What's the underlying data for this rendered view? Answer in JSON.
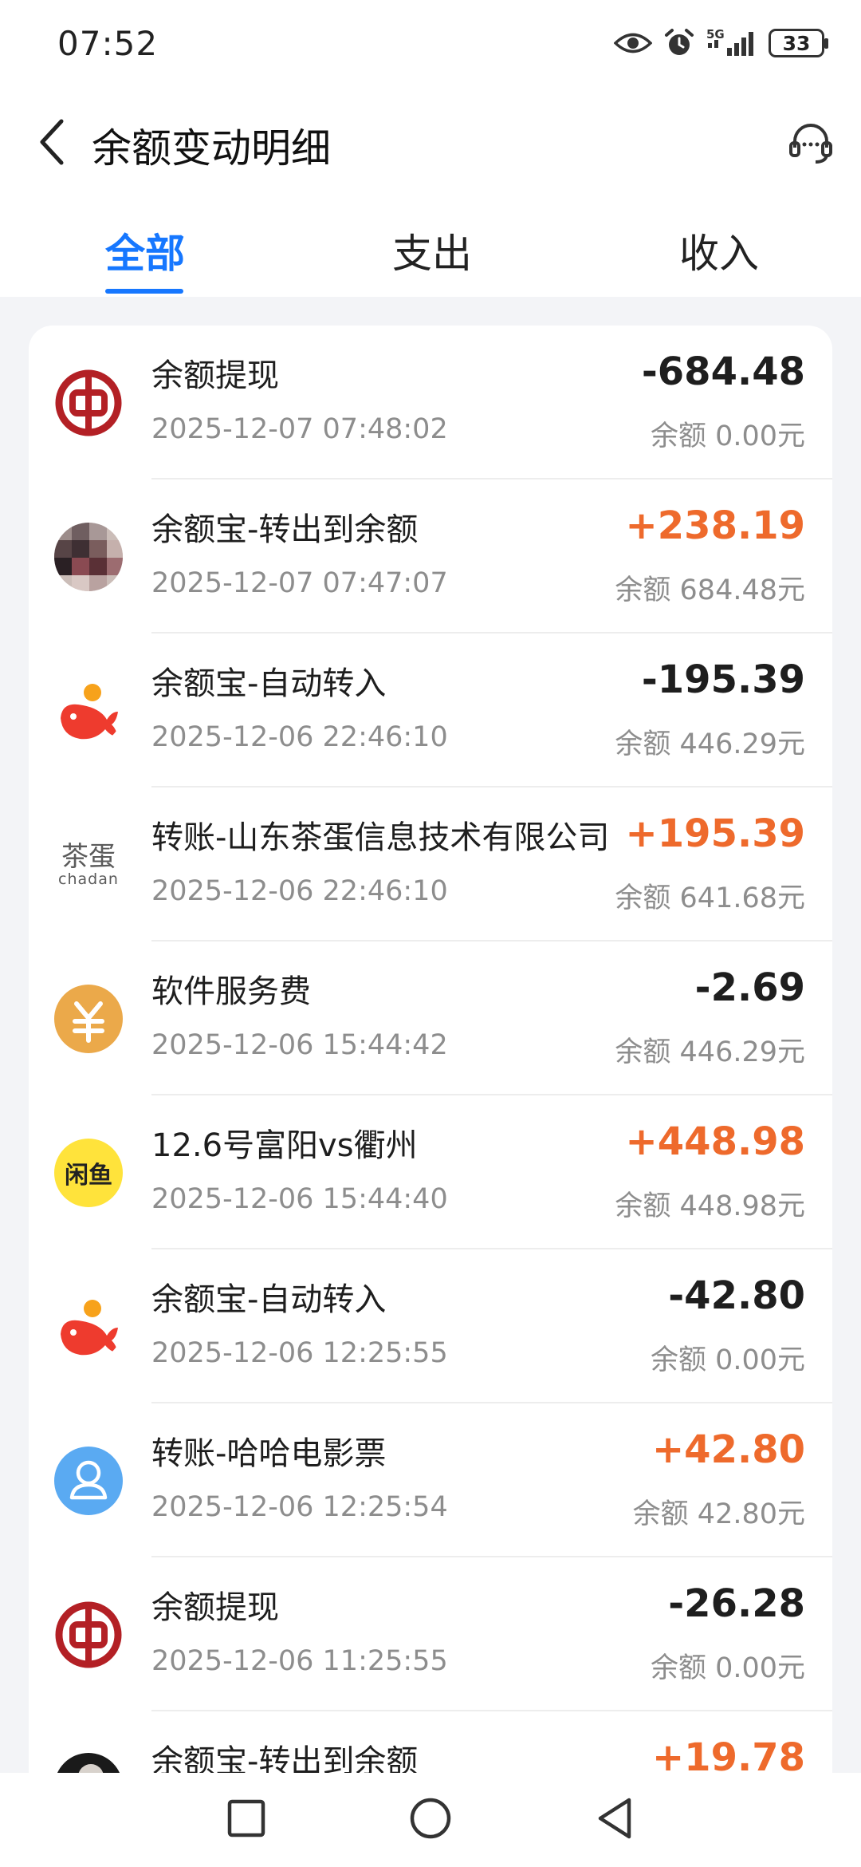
{
  "status_bar": {
    "time": "07:52",
    "network": "5G",
    "battery": "33"
  },
  "header": {
    "title": "余额变动明细"
  },
  "tabs": [
    {
      "label": "全部",
      "active": true
    },
    {
      "label": "支出",
      "active": false
    },
    {
      "label": "收入",
      "active": false
    }
  ],
  "colors": {
    "accent": "#1677ff",
    "income": "#ee6a2c",
    "expense": "#1e1e1e"
  },
  "transactions": [
    {
      "title": "余额提现",
      "time": "2025-12-07 07:48:02",
      "amount": "-684.48",
      "balance": "余额 0.00元",
      "icon": "bank-of-china-icon"
    },
    {
      "title": "余额宝-转出到余额",
      "time": "2025-12-07 07:47:07",
      "amount": "+238.19",
      "balance": "余额 684.48元",
      "icon": "blurred-avatar-icon"
    },
    {
      "title": "余额宝-自动转入",
      "time": "2025-12-06 22:46:10",
      "amount": "-195.39",
      "balance": "余额 446.29元",
      "icon": "yuebao-icon"
    },
    {
      "title": "转账-山东茶蛋信息技术有限公司",
      "time": "2025-12-06 22:46:10",
      "amount": "+195.39",
      "balance": "余额 641.68元",
      "icon": "chadan-logo-icon",
      "logo_text": "茶蛋",
      "logo_subtext": "chadan"
    },
    {
      "title": "软件服务费",
      "time": "2025-12-06 15:44:42",
      "amount": "-2.69",
      "balance": "余额 446.29元",
      "icon": "yuan-coin-icon"
    },
    {
      "title": "12.6号富阳vs衢州",
      "time": "2025-12-06 15:44:40",
      "amount": "+448.98",
      "balance": "余额 448.98元",
      "icon": "xianyu-logo-icon",
      "logo_text": "闲鱼"
    },
    {
      "title": "余额宝-自动转入",
      "time": "2025-12-06 12:25:55",
      "amount": "-42.80",
      "balance": "余额 0.00元",
      "icon": "yuebao-icon"
    },
    {
      "title": "转账-哈哈电影票",
      "time": "2025-12-06 12:25:54",
      "amount": "+42.80",
      "balance": "余额 42.80元",
      "icon": "user-avatar-icon"
    },
    {
      "title": "余额提现",
      "time": "2025-12-06 11:25:55",
      "amount": "-26.28",
      "balance": "余额 0.00元",
      "icon": "bank-of-china-icon"
    },
    {
      "title": "余额宝-转出到余额",
      "time": "",
      "amount": "+19.78",
      "balance": "",
      "icon": "dark-avatar-icon"
    }
  ]
}
